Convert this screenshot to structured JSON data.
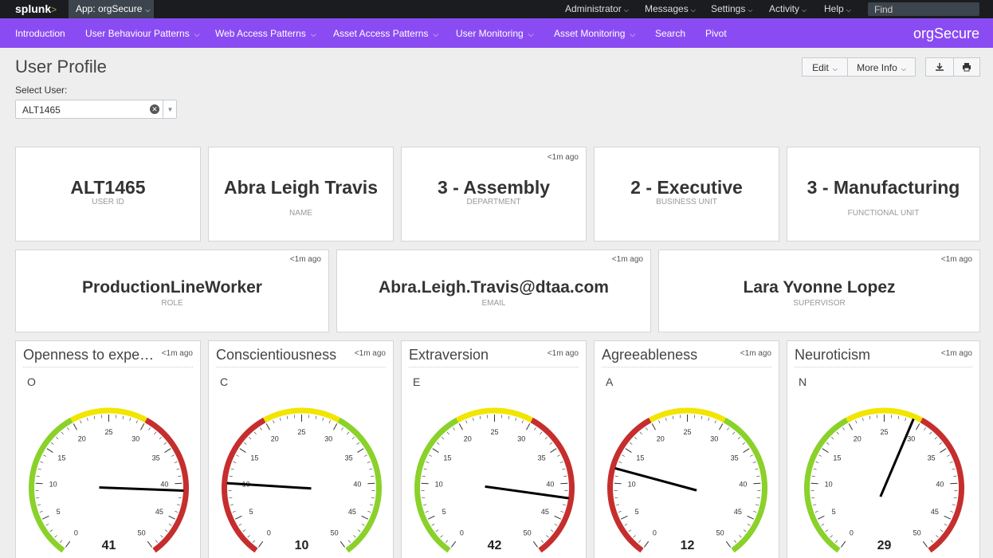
{
  "topbar": {
    "logo": "splunk",
    "logo_suffix": ">",
    "app_selector": "App: orgSecure",
    "menus": [
      "Administrator",
      "Messages",
      "Settings",
      "Activity",
      "Help"
    ],
    "find_placeholder": "Find"
  },
  "appbar": {
    "nav": [
      {
        "label": "Introduction",
        "dropdown": false
      },
      {
        "label": "User Behaviour Patterns",
        "dropdown": true
      },
      {
        "label": "Web Access Patterns",
        "dropdown": true
      },
      {
        "label": "Asset Access Patterns",
        "dropdown": true
      },
      {
        "label": "User Monitoring",
        "dropdown": true
      },
      {
        "label": "Asset Monitoring",
        "dropdown": true
      },
      {
        "label": "Search",
        "dropdown": false
      },
      {
        "label": "Pivot",
        "dropdown": false
      }
    ],
    "app_name": "orgSecure",
    "color": "#8a4cf2"
  },
  "page": {
    "title": "User Profile",
    "edit_label": "Edit",
    "more_info_label": "More Info",
    "export_icon": "download-icon",
    "print_icon": "print-icon"
  },
  "select_user": {
    "label": "Select User:",
    "value": "ALT1465"
  },
  "profile_row1": [
    {
      "value": "ALT1465",
      "caption": "USER ID",
      "ago": ""
    },
    {
      "value": "Abra Leigh Travis",
      "caption": "NAME",
      "ago": ""
    },
    {
      "value": "3 - Assembly",
      "caption": "DEPARTMENT",
      "ago": "<1m ago"
    },
    {
      "value": "2 - Executive",
      "caption": "BUSINESS UNIT",
      "ago": ""
    },
    {
      "value": "3 - Manufacturing",
      "caption": "FUNCTIONAL UNIT",
      "ago": ""
    }
  ],
  "profile_row2": [
    {
      "value": "ProductionLineWorker",
      "caption": "ROLE",
      "ago": "<1m ago"
    },
    {
      "value": "Abra.Leigh.Travis@dtaa.com",
      "caption": "EMAIL",
      "ago": "<1m ago"
    },
    {
      "value": "Lara Yvonne Lopez",
      "caption": "SUPERVISOR",
      "ago": "<1m ago"
    }
  ],
  "gauges": [
    {
      "title": "Openness to experi...",
      "letter": "O",
      "value": 41,
      "ago": "<1m ago",
      "bands": [
        [
          "#8ad12a",
          0,
          20
        ],
        [
          "#f2e500",
          20,
          30
        ],
        [
          "#c62e2e",
          30,
          50
        ]
      ]
    },
    {
      "title": "Conscientiousness",
      "letter": "C",
      "value": 10,
      "ago": "<1m ago",
      "bands": [
        [
          "#c62e2e",
          0,
          20
        ],
        [
          "#f2e500",
          20,
          30
        ],
        [
          "#8ad12a",
          30,
          50
        ]
      ]
    },
    {
      "title": "Extraversion",
      "letter": "E",
      "value": 42,
      "ago": "<1m ago",
      "bands": [
        [
          "#8ad12a",
          0,
          20
        ],
        [
          "#f2e500",
          20,
          30
        ],
        [
          "#c62e2e",
          30,
          50
        ]
      ]
    },
    {
      "title": "Agreeableness",
      "letter": "A",
      "value": 12,
      "ago": "<1m ago",
      "bands": [
        [
          "#c62e2e",
          0,
          20
        ],
        [
          "#f2e500",
          20,
          30
        ],
        [
          "#8ad12a",
          30,
          50
        ]
      ]
    },
    {
      "title": "Neuroticism",
      "letter": "N",
      "value": 29,
      "ago": "<1m ago",
      "bands": [
        [
          "#8ad12a",
          0,
          20
        ],
        [
          "#f2e500",
          20,
          30
        ],
        [
          "#c62e2e",
          30,
          50
        ]
      ]
    }
  ],
  "gauge_scale": {
    "min": 0,
    "max": 50,
    "ticks": [
      0,
      5,
      10,
      15,
      20,
      25,
      30,
      35,
      40,
      45,
      50
    ]
  }
}
